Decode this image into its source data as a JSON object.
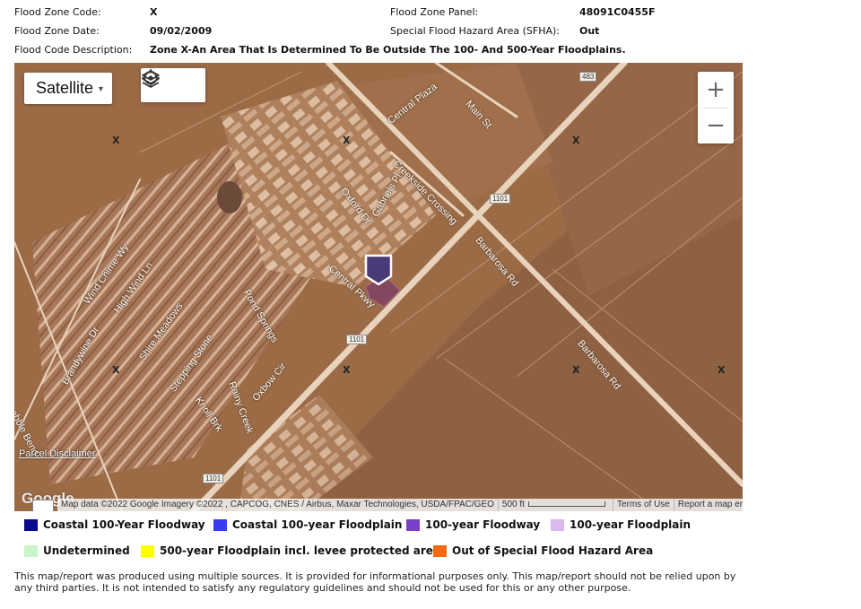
{
  "info": {
    "flood_zone_code_label": "Flood Zone Code:",
    "flood_zone_code": "X",
    "flood_zone_date_label": "Flood Zone Date:",
    "flood_zone_date": "09/02/2009",
    "flood_code_desc_label": "Flood Code Description:",
    "flood_code_desc": "Zone X-An Area That Is Determined To Be Outside The 100- And 500-Year Floodplains.",
    "flood_zone_panel_label": "Flood Zone Panel:",
    "flood_zone_panel": "48091C0455F",
    "sfha_label": "Special Flood Hazard Area (SFHA):",
    "sfha": "Out"
  },
  "map": {
    "map_type": "Satellite",
    "icons": [
      "layers-icon",
      "locate-icon",
      "zoom-in-icon",
      "zoom-out-icon",
      "location-pin-icon"
    ],
    "zoom_in": "+",
    "zoom_out": "−",
    "roads": {
      "central_plaza": "Central Plaza",
      "main_st": "Main St",
      "creekside": "Creekside Crossing",
      "gabriels": "Gabriels Pl",
      "oxford": "Oxford Dr",
      "central_pkwy": "Central Pkwy",
      "barbarosa1": "Barbarosa Rd",
      "barbarosa2": "Barbarosa Rd",
      "wind_chime": "Wind Chime Wy",
      "high_wind": "High Wind Ln",
      "brandywine": "Brandywine Dr",
      "shire": "Shire Meadows",
      "pond": "Pond Springs",
      "stepping": "Stepping Stone",
      "rainy": "Rainy Creek",
      "oxbow": "Oxbow Cir",
      "knoll": "Knoll Brk",
      "pebble": "ebble Bend",
      "shield_483": "483",
      "shield_1101a": "1101",
      "shield_1101b": "1101",
      "shield_1101c": "1101"
    },
    "zone_mark": "X",
    "parcel_disclaimer": "Parcel Disclaimer",
    "google": "Google",
    "attribution": "Map data ©2022 Google Imagery ©2022 , CAPCOG, CNES / Airbus, Maxar Technologies, USDA/FPAC/GEO",
    "scale": "500 ft",
    "terms": "Terms of Use",
    "report": "Report a map error"
  },
  "legend": [
    {
      "label": "Coastal 100-Year Floodway",
      "color": "#0a0a8c"
    },
    {
      "label": "Coastal 100-year Floodplain",
      "color": "#3a3af0"
    },
    {
      "label": "100-year Floodway",
      "color": "#7a3fc8"
    },
    {
      "label": "100-year Floodplain",
      "color": "#dcb8f0"
    },
    {
      "label": "Undetermined",
      "color": "#c8f5c8"
    },
    {
      "label": "500-year Floodplain incl. levee protected area",
      "color": "#ffff00"
    },
    {
      "label": "Out of Special Flood Hazard Area",
      "color": "#f26a10"
    }
  ],
  "disclaimer": "This map/report was produced using multiple sources. It is provided for informational purposes only. This map/report should not be relied upon by any third parties. It is not intended to satisfy any regulatory guidelines and should not be used for this or any other purpose."
}
